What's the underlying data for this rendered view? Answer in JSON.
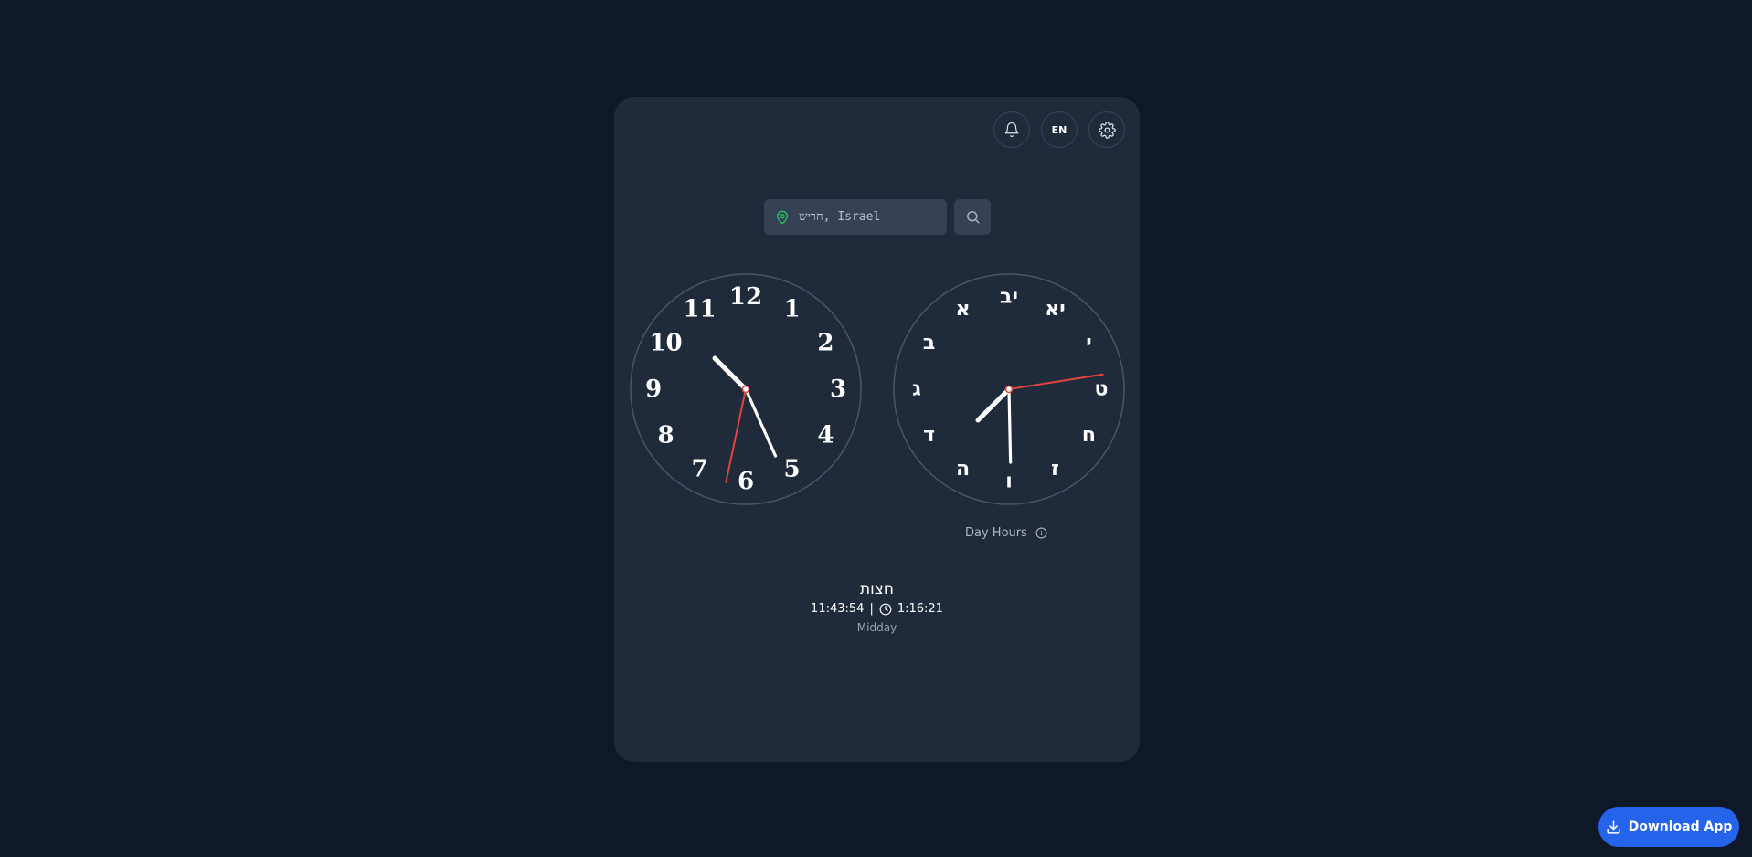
{
  "header": {
    "notification_icon": "bell-icon",
    "language_label": "EN",
    "settings_icon": "gear-icon"
  },
  "location": {
    "pin_icon": "map-pin-icon",
    "placeholder": "חריש, Israel",
    "search_icon": "search-icon"
  },
  "standard_clock": {
    "numerals": [
      "12",
      "1",
      "2",
      "3",
      "4",
      "5",
      "6",
      "7",
      "8",
      "9",
      "10",
      "11"
    ],
    "hour": 10.5,
    "minute": 26,
    "second": 32
  },
  "hebrew_clock": {
    "numerals": [
      "יב",
      "יא",
      "י",
      "ט",
      "ח",
      "ז",
      "ו",
      "ה",
      "ד",
      "ג",
      "ב",
      "א"
    ],
    "hour": 7.5,
    "minute": 29.8,
    "second": 13.5,
    "label": "Day Hours",
    "info_icon": "info-icon"
  },
  "zman": {
    "name": "חצות",
    "time": "11:43:54",
    "separator": "|",
    "clock_icon": "clock-icon",
    "relative_time": "1:16:21",
    "subtitle": "Midday"
  },
  "download": {
    "icon": "download-icon",
    "label": "Download App"
  },
  "colors": {
    "background": "#0f1828",
    "card": "#1f2a3b",
    "second_hand": "#e0443e",
    "accent": "#2563eb",
    "pin": "#22c55e"
  }
}
